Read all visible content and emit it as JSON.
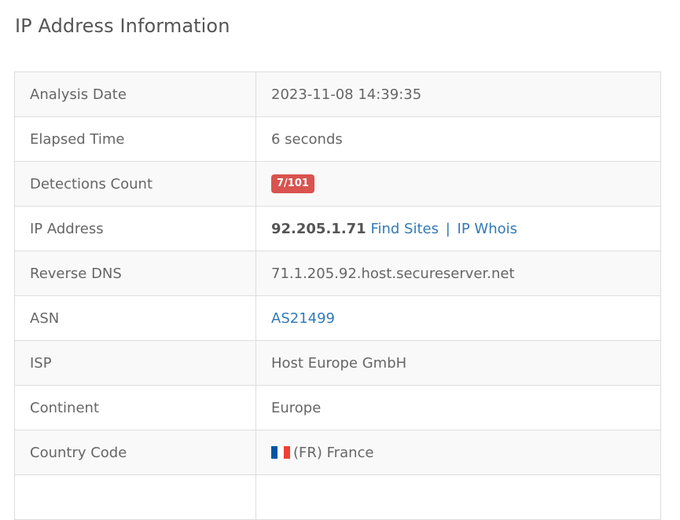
{
  "page": {
    "title": "IP Address Information"
  },
  "rows": {
    "analysis_date": {
      "label": "Analysis Date",
      "value": "2023-11-08 14:39:35"
    },
    "elapsed_time": {
      "label": "Elapsed Time",
      "value": "6 seconds"
    },
    "detections_count": {
      "label": "Detections Count",
      "value": "7/101",
      "badge_color": "#d9534f"
    },
    "ip_address": {
      "label": "IP Address",
      "value": "92.205.1.71",
      "find_sites_link": "Find Sites",
      "separator": "|",
      "ip_whois_link": "IP Whois"
    },
    "reverse_dns": {
      "label": "Reverse DNS",
      "value": "71.1.205.92.host.secureserver.net"
    },
    "asn": {
      "label": "ASN",
      "value": "AS21499"
    },
    "isp": {
      "label": "ISP",
      "value": "Host Europe GmbH"
    },
    "continent": {
      "label": "Continent",
      "value": "Europe"
    },
    "country_code": {
      "label": "Country Code",
      "value": "(FR) France",
      "flag_icon": "france-flag-icon"
    }
  },
  "colors": {
    "link": "#337ab7",
    "badge_danger": "#d9534f",
    "stripe": "#f9f9f9",
    "border": "#dddddd"
  }
}
